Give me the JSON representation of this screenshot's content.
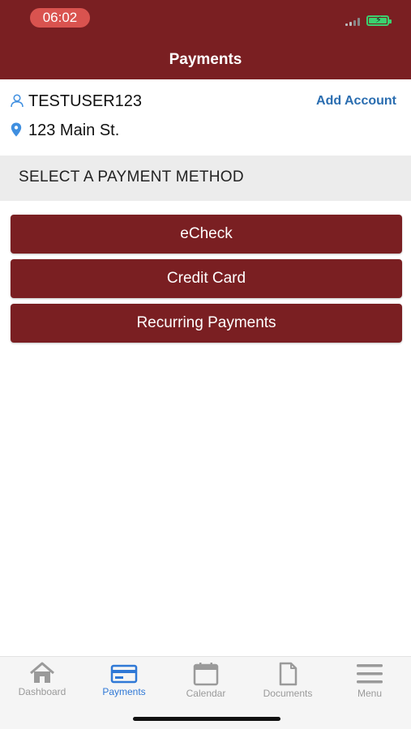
{
  "status_bar": {
    "time": "06:02"
  },
  "header": {
    "title": "Payments"
  },
  "account": {
    "user_icon": "user-icon",
    "username": "TESTUSER123",
    "add_account_label": "Add Account",
    "location_icon": "location-pin-icon",
    "address": "123 Main St."
  },
  "section": {
    "title": "SELECT A PAYMENT METHOD"
  },
  "payment_methods": [
    {
      "label": "eCheck"
    },
    {
      "label": "Credit Card"
    },
    {
      "label": "Recurring Payments"
    }
  ],
  "tabs": [
    {
      "label": "Dashboard",
      "icon": "home-icon",
      "active": false
    },
    {
      "label": "Payments",
      "icon": "credit-card-icon",
      "active": true
    },
    {
      "label": "Calendar",
      "icon": "calendar-icon",
      "active": false
    },
    {
      "label": "Documents",
      "icon": "document-icon",
      "active": false
    },
    {
      "label": "Menu",
      "icon": "menu-icon",
      "active": false
    }
  ],
  "colors": {
    "brand": "#7a1f22",
    "link": "#2a6db0",
    "active_tab": "#2f78d6",
    "inactive_tab": "#9a9a9a",
    "section_band": "#ececec"
  }
}
